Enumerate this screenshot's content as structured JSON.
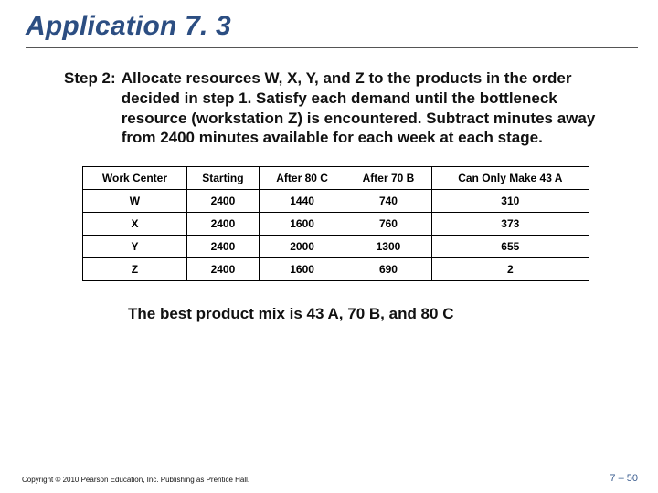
{
  "title": "Application 7. 3",
  "step": {
    "label": "Step 2:",
    "body": "Allocate resources W, X, Y, and Z to the products in the order decided in step 1. Satisfy each demand until the bottleneck resource (workstation Z) is encountered. Subtract minutes away from 2400 minutes available for each week at each stage."
  },
  "table": {
    "headers": [
      "Work Center",
      "Starting",
      "After 80 C",
      "After 70 B",
      "Can Only Make 43 A"
    ],
    "rows": [
      {
        "wc": "W",
        "c0": "2400",
        "c1": "1440",
        "c2": "740",
        "c3": "310"
      },
      {
        "wc": "X",
        "c0": "2400",
        "c1": "1600",
        "c2": "760",
        "c3": "373"
      },
      {
        "wc": "Y",
        "c0": "2400",
        "c1": "2000",
        "c2": "1300",
        "c3": "655"
      },
      {
        "wc": "Z",
        "c0": "2400",
        "c1": "1600",
        "c2": "690",
        "c3": "2"
      }
    ]
  },
  "conclusion": "The best product mix is 43 A, 70 B, and 80 C",
  "footer": {
    "copyright": "Copyright © 2010 Pearson Education, Inc. Publishing as Prentice Hall.",
    "pagenum": "7 – 50"
  },
  "chart_data": {
    "type": "table",
    "title": "Resource minutes remaining after allocating products",
    "columns": [
      "Work Center",
      "Starting",
      "After 80 C",
      "After 70 B",
      "Can Only Make 43 A"
    ],
    "rows": [
      [
        "W",
        2400,
        1440,
        740,
        310
      ],
      [
        "X",
        2400,
        1600,
        760,
        373
      ],
      [
        "Y",
        2400,
        2000,
        1300,
        655
      ],
      [
        "Z",
        2400,
        1600,
        690,
        2
      ]
    ]
  }
}
